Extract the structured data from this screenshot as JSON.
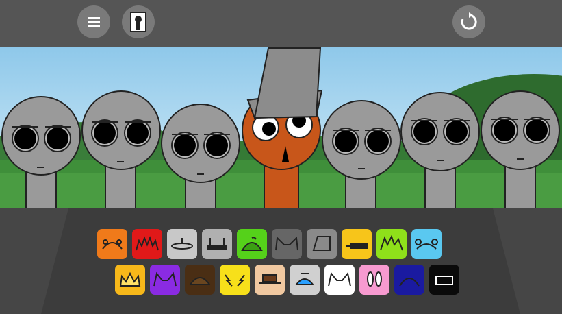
{
  "toolbar": {
    "menu_icon": "hamburger-menu-icon",
    "portrait_icon": "portrait-keyhole-icon",
    "reset_icon": "reset-arrow-icon"
  },
  "stage": {
    "characters": [
      {
        "id": "gray-1",
        "color": "#9a9a9a"
      },
      {
        "id": "gray-2",
        "color": "#9a9a9a"
      },
      {
        "id": "gray-3",
        "color": "#9a9a9a"
      },
      {
        "id": "orange-bucket",
        "color": "#c8561a",
        "hat": "bucket"
      },
      {
        "id": "gray-4",
        "color": "#9a9a9a"
      },
      {
        "id": "gray-5",
        "color": "#9a9a9a"
      },
      {
        "id": "gray-6",
        "color": "#9a9a9a"
      }
    ]
  },
  "palette": {
    "row1": [
      {
        "name": "orange-antenna",
        "bg": "#f07a1a"
      },
      {
        "name": "red-spiky",
        "bg": "#e01919"
      },
      {
        "name": "silver-saucer",
        "bg": "#c8c8c8"
      },
      {
        "name": "gray-headphones",
        "bg": "#b0b0b0"
      },
      {
        "name": "green-pumpkin",
        "bg": "#55d11a"
      },
      {
        "name": "gray-cat-ears",
        "bg": "#666666"
      },
      {
        "name": "gray-bucket",
        "bg": "#8a8a8a"
      },
      {
        "name": "yellow-cap",
        "bg": "#f7c51a"
      },
      {
        "name": "lime-spiky",
        "bg": "#8fe01a"
      },
      {
        "name": "cyan-bear-ears",
        "bg": "#5ac8f0"
      }
    ],
    "row2": [
      {
        "name": "gold-crown",
        "bg": "#f7b81a"
      },
      {
        "name": "purple-horns",
        "bg": "#8a2be2"
      },
      {
        "name": "brown-helmet",
        "bg": "#4a2e14"
      },
      {
        "name": "yellow-lightning",
        "bg": "#f7e01a"
      },
      {
        "name": "tan-hat",
        "bg": "#f0c8a0"
      },
      {
        "name": "propeller-cap",
        "bg": "#d0d0d0"
      },
      {
        "name": "white-cat-ears",
        "bg": "#ffffff"
      },
      {
        "name": "pink-bunny-ears",
        "bg": "#f79ad0"
      },
      {
        "name": "navy-dome",
        "bg": "#1a1aa0"
      },
      {
        "name": "black-box",
        "bg": "#0a0a0a"
      }
    ]
  }
}
